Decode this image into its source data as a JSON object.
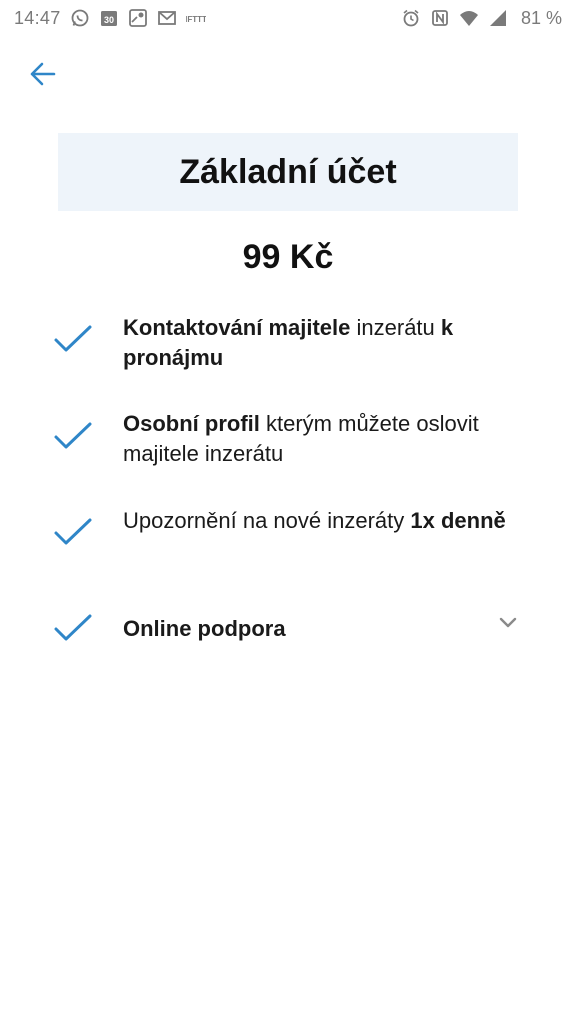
{
  "status_bar": {
    "time": "14:47",
    "battery": "81 %",
    "left_icons": [
      "whatsapp-icon",
      "calendar-icon",
      "maps-icon",
      "mail-icon",
      "ifttt-icon"
    ],
    "right_icons": [
      "alarm-icon",
      "nfc-icon",
      "wifi-icon",
      "signal-icon"
    ],
    "calendar_day": "30",
    "ifttt_label": "IFTTT"
  },
  "back_button": {
    "icon": "arrow-left-icon",
    "color": "#2f86c8"
  },
  "plan": {
    "title": "Základní účet",
    "price": "99 Kč",
    "header_bg": "#eef4fa"
  },
  "features": [
    {
      "parts": [
        {
          "text": "Kontaktování majitele",
          "bold": true
        },
        {
          "text": " inzerátu ",
          "bold": false
        },
        {
          "text": "k pronájmu",
          "bold": true
        }
      ]
    },
    {
      "parts": [
        {
          "text": "Osobní profil",
          "bold": true
        },
        {
          "text": " kterým můžete oslovit majitele inzerátu",
          "bold": false
        }
      ]
    },
    {
      "parts": [
        {
          "text": "Upozornění na nové inzeráty ",
          "bold": false
        },
        {
          "text": "1x denně",
          "bold": true
        }
      ]
    },
    {
      "parts": [
        {
          "text": "Online podpora",
          "bold": true
        }
      ]
    }
  ],
  "check_color": "#2f86c8",
  "expand_icon": "chevron-down-icon"
}
